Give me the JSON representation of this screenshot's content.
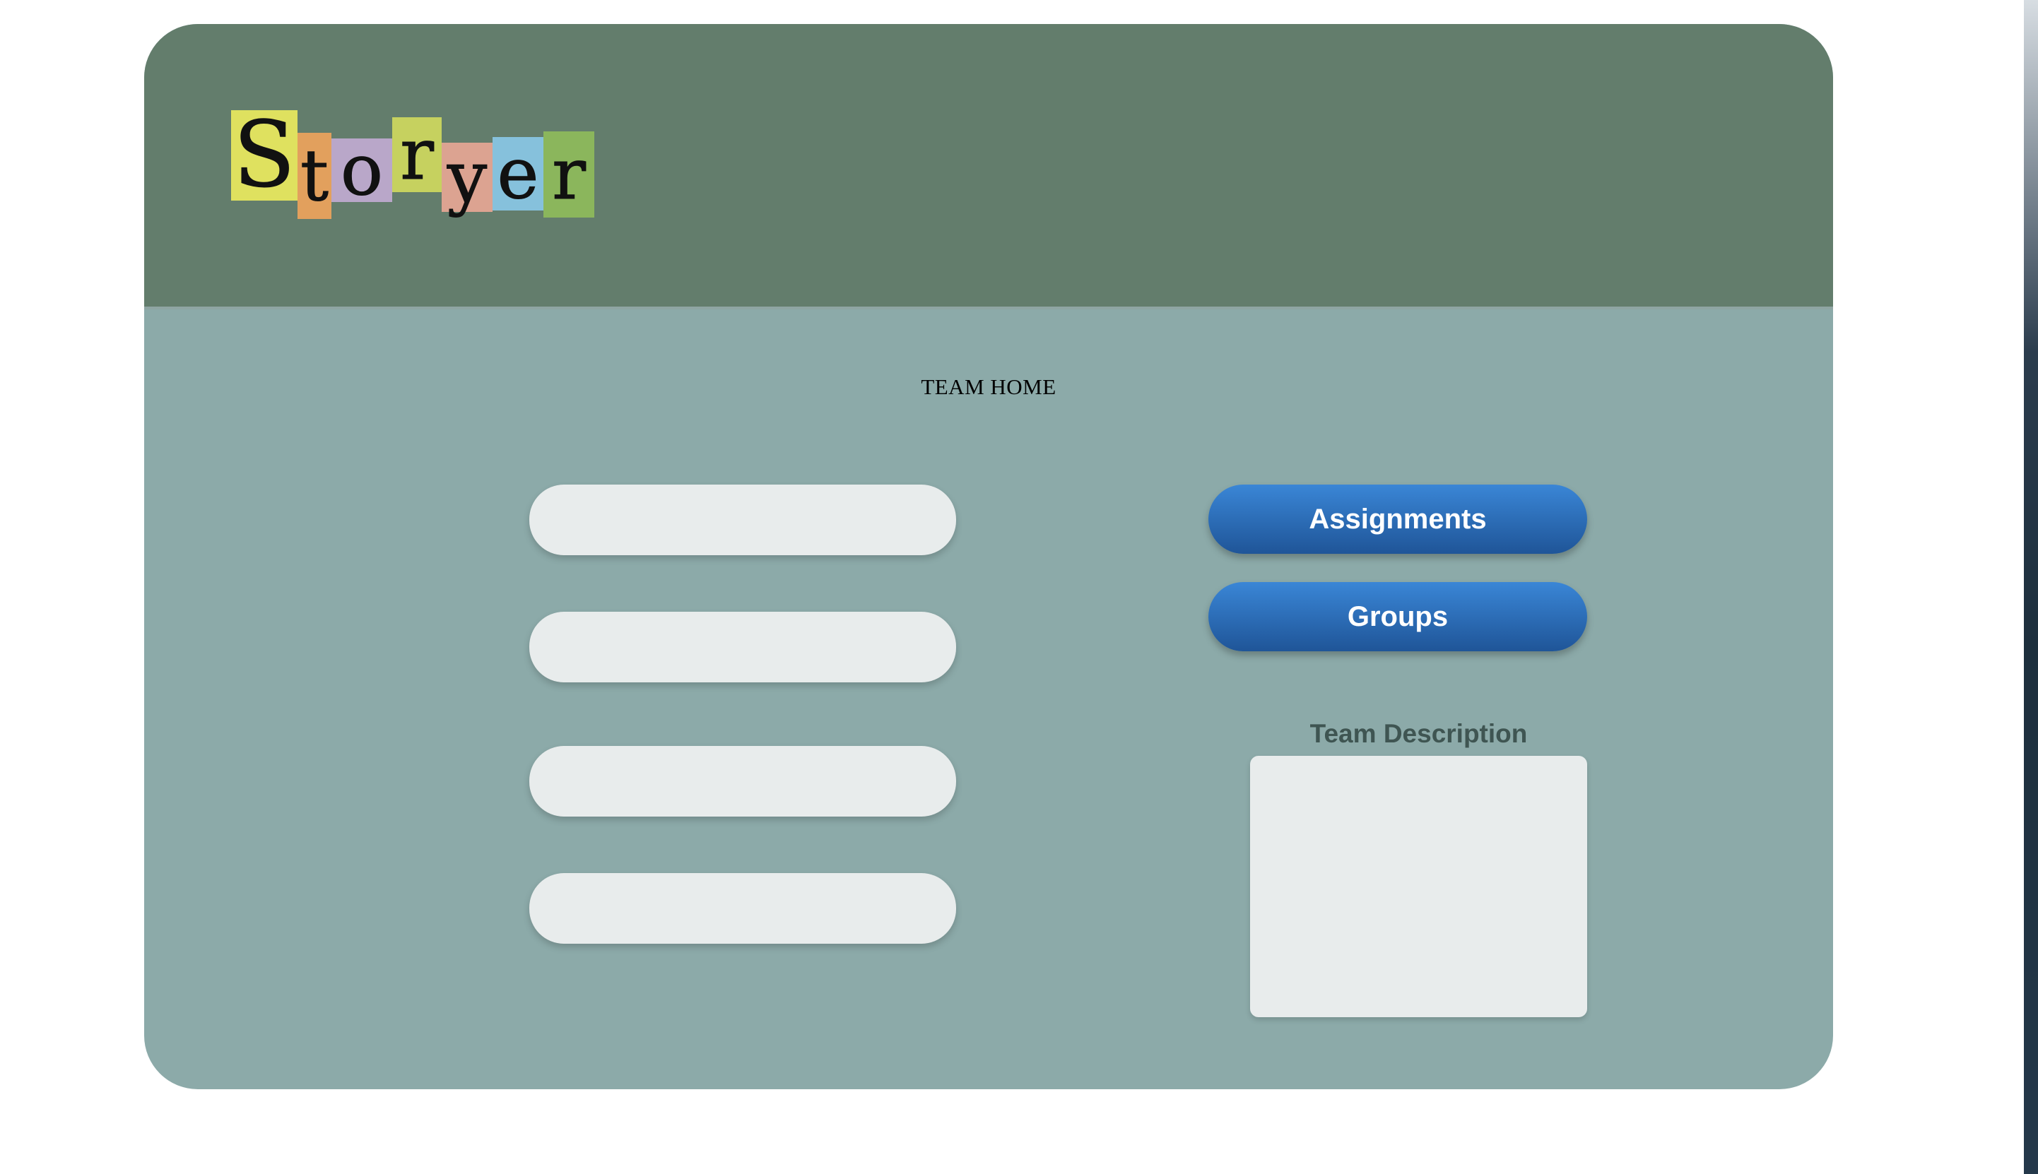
{
  "header": {
    "logo_letters": [
      {
        "char": "S",
        "color": "#dfe15f"
      },
      {
        "char": "t",
        "color": "#e2a05d"
      },
      {
        "char": "o",
        "color": "#b9a7c9"
      },
      {
        "char": "r",
        "color": "#c6d15f"
      },
      {
        "char": "y",
        "color": "#dca391"
      },
      {
        "char": "e",
        "color": "#86c1dc"
      },
      {
        "char": "r",
        "color": "#8bb65c"
      }
    ]
  },
  "main": {
    "title": "TEAM HOME",
    "inputs": [
      {
        "value": ""
      },
      {
        "value": ""
      },
      {
        "value": ""
      },
      {
        "value": ""
      }
    ],
    "buttons": {
      "assignments": "Assignments",
      "groups": "Groups"
    },
    "description": {
      "label": "Team Description",
      "value": ""
    }
  },
  "colors": {
    "header_bg": "#637d6c",
    "body_bg": "#8caaa9",
    "button_top": "#3a86d6",
    "button_bottom": "#1f5598",
    "field_bg": "#e8ecec"
  }
}
